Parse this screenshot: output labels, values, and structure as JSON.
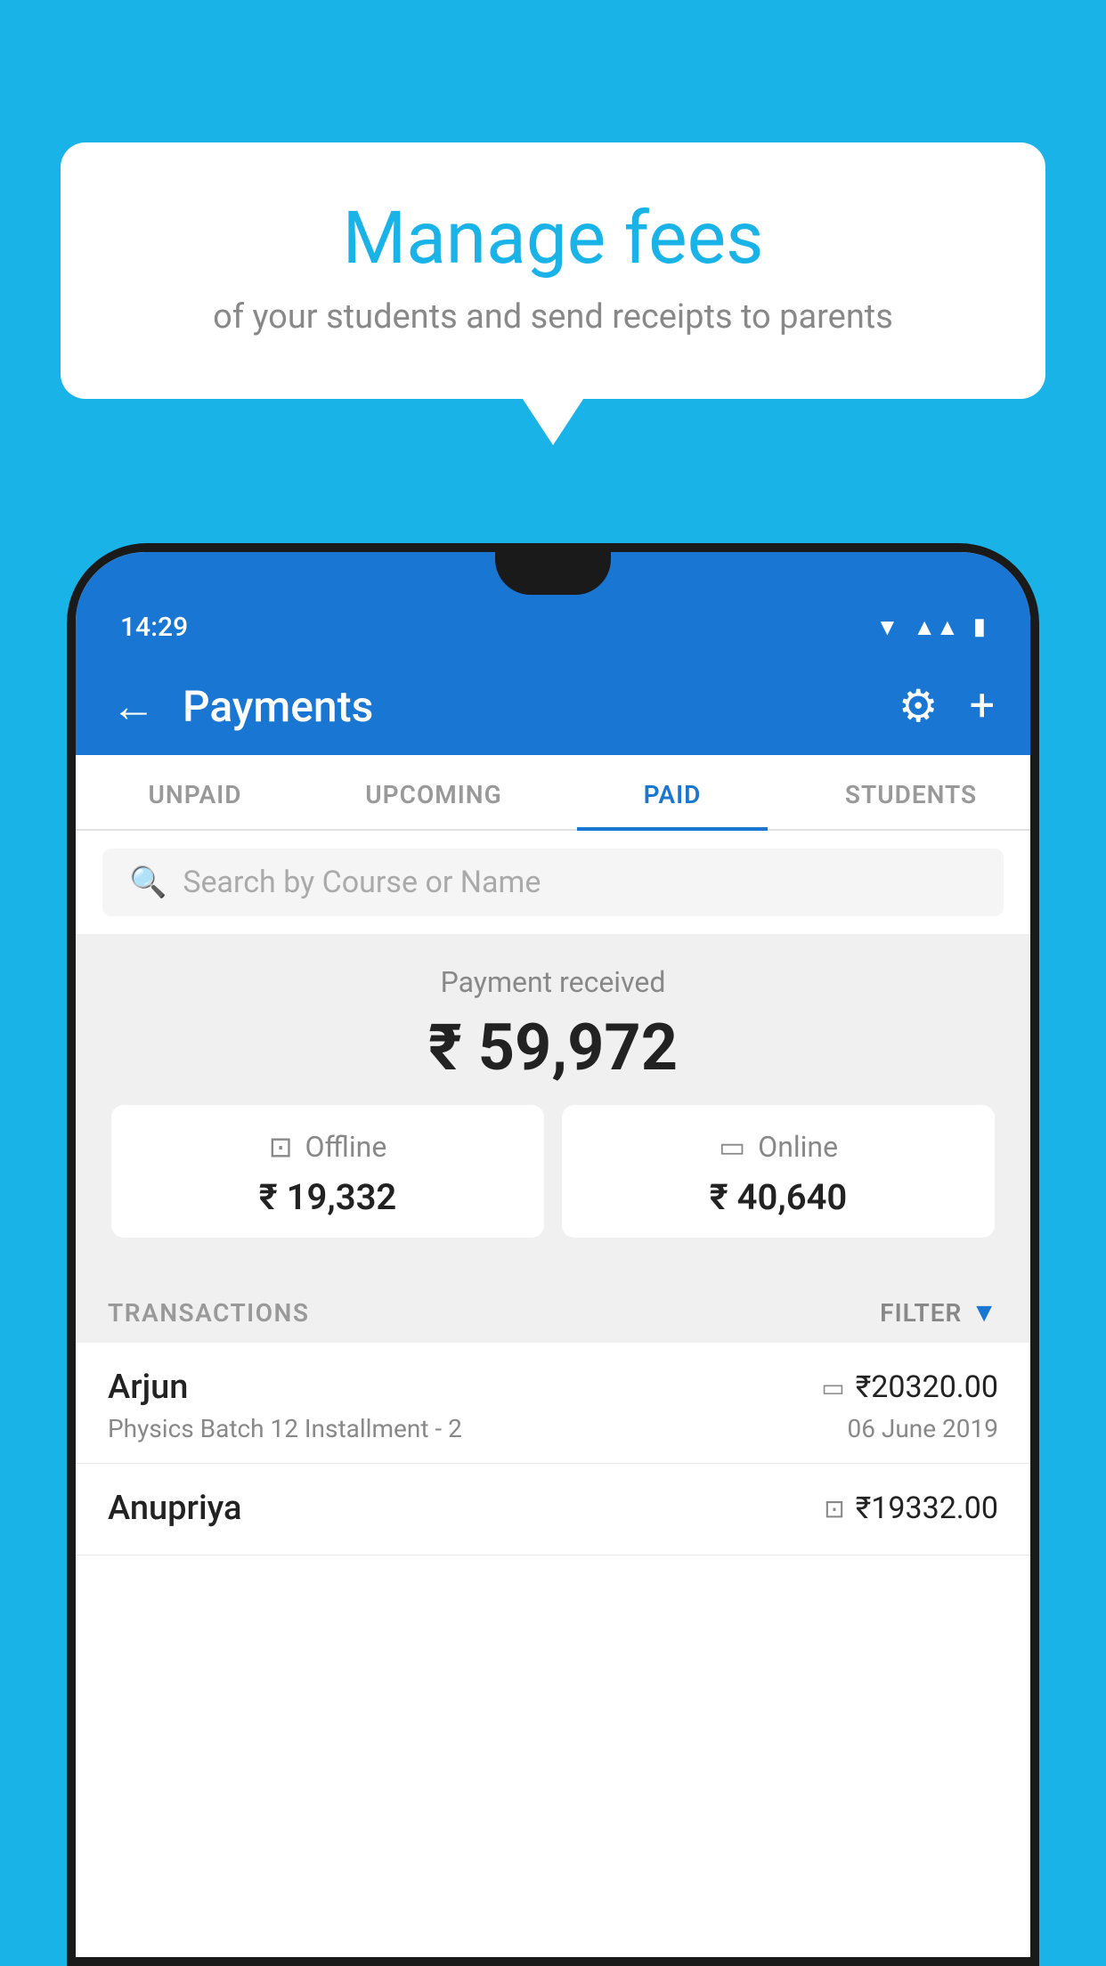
{
  "background_color": "#1ab3e8",
  "bubble": {
    "title": "Manage fees",
    "subtitle": "of your students and send receipts to parents"
  },
  "status_bar": {
    "time": "14:29",
    "icons": [
      "wifi",
      "signal",
      "battery"
    ]
  },
  "app_bar": {
    "title": "Payments",
    "back_icon": "←",
    "settings_icon": "⚙",
    "add_icon": "+"
  },
  "tabs": [
    {
      "label": "UNPAID",
      "active": false
    },
    {
      "label": "UPCOMING",
      "active": false
    },
    {
      "label": "PAID",
      "active": true
    },
    {
      "label": "STUDENTS",
      "active": false
    }
  ],
  "search": {
    "placeholder": "Search by Course or Name"
  },
  "payment": {
    "label": "Payment received",
    "amount": "₹ 59,972",
    "offline_label": "Offline",
    "offline_amount": "₹ 19,332",
    "online_label": "Online",
    "online_amount": "₹ 40,640"
  },
  "transactions": {
    "header_label": "TRANSACTIONS",
    "filter_label": "FILTER",
    "items": [
      {
        "name": "Arjun",
        "amount": "₹20320.00",
        "mode": "card",
        "course": "Physics Batch 12 Installment - 2",
        "date": "06 June 2019"
      },
      {
        "name": "Anupriya",
        "amount": "₹19332.00",
        "mode": "cash",
        "course": "",
        "date": ""
      }
    ]
  }
}
